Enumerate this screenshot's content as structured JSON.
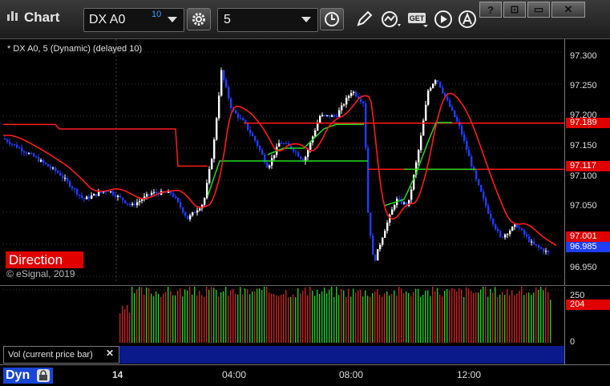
{
  "window": {
    "title": "Chart",
    "controls": [
      "?",
      "⊡",
      "▭",
      "✕"
    ]
  },
  "toolbar": {
    "symbol": "DX A0",
    "symbol_delay": "10",
    "interval": "5",
    "icons": [
      "gear-icon",
      "clock-icon",
      "pencil-icon",
      "study-icon",
      "get-icon",
      "play-icon",
      "a-icon"
    ],
    "get_label": "GET"
  },
  "chart": {
    "header": "* DX A0, 5 (Dynamic) (delayed 10)",
    "indicator_badge": "Direction",
    "copyright": "© eSignal, 2019",
    "price_axis_labels": [
      "97.300",
      "97.250",
      "97.200",
      "97.150",
      "97.100",
      "97.050",
      "96.950"
    ],
    "price_tags": {
      "upper_level": "97.189",
      "mid_level": "97.117",
      "ma_value": "97.001",
      "last_price": "96.985"
    },
    "colors": {
      "up_bar": "#ffffff",
      "down_bar": "#1f3cff",
      "ma_line": "#ff1a1a",
      "green_line": "#22dd22",
      "level_line": "#ff1a1a",
      "tag_red": "#e00000",
      "tag_blue": "#1f3cff"
    }
  },
  "volume": {
    "label": "Vol (current price bar)",
    "axis_labels": [
      "250",
      "0"
    ],
    "current_value": "204"
  },
  "time_axis": {
    "mode": "Dyn",
    "labels": [
      "14",
      "04:00",
      "08:00",
      "12:00"
    ]
  },
  "chart_data": {
    "type": "candlestick",
    "price_range": [
      96.94,
      97.32
    ],
    "levels": [
      97.189,
      97.117
    ],
    "last_price": 96.985,
    "ma_last": 97.001,
    "volume_last": 204,
    "volume_range": [
      0,
      250
    ]
  }
}
